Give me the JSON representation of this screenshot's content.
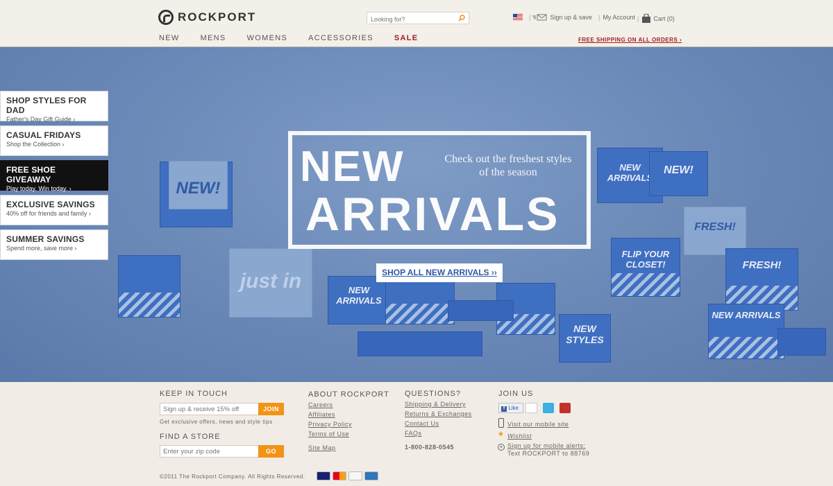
{
  "header": {
    "brand": "ROCKPORT",
    "search_placeholder": "Looking for?",
    "utility": {
      "signup": "Sign up & save",
      "account": "My Account",
      "cart": "Cart (0)"
    },
    "nav": [
      "NEW",
      "MENS",
      "WOMENS",
      "ACCESSORIES",
      "SALE"
    ],
    "free_shipping": "FREE SHIPPING ON ALL ORDERS ›"
  },
  "promos": [
    {
      "title": "SHOP STYLES FOR DAD",
      "sub": "Father's Day Gift Guide ›"
    },
    {
      "title": "CASUAL FRIDAYS",
      "sub": "Shop the Collection ›"
    },
    {
      "title": "FREE SHOE GIVEAWAY",
      "sub": "Play today. Win today. ›"
    },
    {
      "title": "EXCLUSIVE SAVINGS",
      "sub": "40% off for friends and family ›"
    },
    {
      "title": "SUMMER SAVINGS",
      "sub": "Spend more, save more ›"
    }
  ],
  "hero": {
    "headline_1": "NEW",
    "headline_2": "ARRIVALS",
    "subtitle": "Check out the freshest styles of the season",
    "cta": "SHOP ALL NEW ARRIVALS ››",
    "box_labels": [
      "NEW!",
      "just in",
      "NEW ARRIVALS",
      "NEW ARRIVALS",
      "NEW!",
      "FRESH!",
      "FLIP YOUR CLOSET!",
      "FRESH!",
      "NEW STYLES",
      "NEW ARRIVALS"
    ]
  },
  "footer": {
    "keep_in_touch": {
      "heading": "KEEP IN TOUCH",
      "placeholder": "Sign up & receive 15% off",
      "button": "JOIN",
      "note": "Get exclusive offers, news and style tips"
    },
    "find_store": {
      "heading": "FIND A STORE",
      "placeholder": "Enter your zip code",
      "button": "GO"
    },
    "about": {
      "heading": "ABOUT ROCKPORT",
      "links": [
        "Careers",
        "Affiliates",
        "Privacy Policy",
        "Terms of Use"
      ],
      "sitemap": "Site Map"
    },
    "questions": {
      "heading": "QUESTIONS?",
      "links": [
        "Shipping & Delivery",
        "Returns & Exchanges",
        "Contact Us",
        "FAQs"
      ],
      "phone": "1-800-828-0545"
    },
    "join": {
      "heading": "JOIN US",
      "like": "Like",
      "mobile": "Visit our mobile site",
      "wishlist": "Wishlist",
      "alerts_1": "Sign up for mobile alerts:",
      "alerts_2": "Text ROCKPORT to 88769"
    },
    "copyright": "©2011 The Rockport Company. All Rights Reserved."
  }
}
